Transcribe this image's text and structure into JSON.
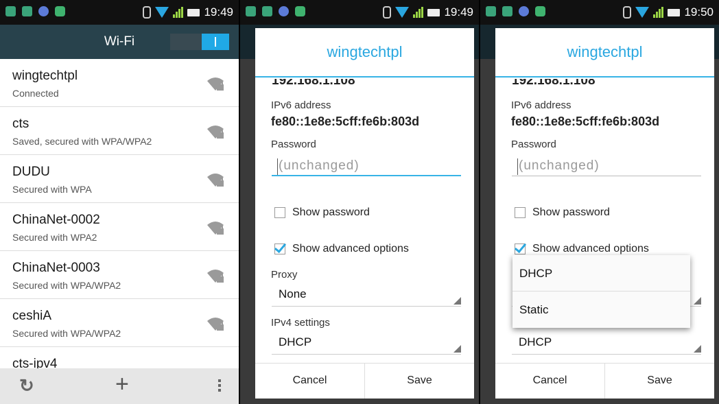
{
  "statusbar": {
    "time1": "19:49",
    "time2": "19:49",
    "time3": "19:50"
  },
  "wifi": {
    "title": "Wi-Fi",
    "networks": [
      {
        "name": "wingtechtpl",
        "status": "Connected"
      },
      {
        "name": "cts",
        "status": "Saved, secured with WPA/WPA2"
      },
      {
        "name": "DUDU",
        "status": "Secured with WPA"
      },
      {
        "name": "ChinaNet-0002",
        "status": "Secured with WPA2"
      },
      {
        "name": "ChinaNet-0003",
        "status": "Secured with WPA/WPA2"
      },
      {
        "name": "ceshiA",
        "status": "Secured with WPA/WPA2"
      },
      {
        "name": "cts-ipv4",
        "status": ""
      }
    ],
    "bottom": {
      "refresh": "↻",
      "add": "+"
    }
  },
  "dialog": {
    "title": "wingtechtpl",
    "ipv4_value": "192.168.1.108",
    "ipv6_label": "IPv6 address",
    "ipv6_value": "fe80::1e8e:5cff:fe6b:803d",
    "password_label": "Password",
    "password_placeholder": "(unchanged)",
    "show_password": "Show password",
    "show_advanced": "Show advanced options",
    "proxy_label": "Proxy",
    "proxy_value": "None",
    "ipv4_settings_label": "IPv4 settings",
    "ipv4_settings_value": "DHCP",
    "cancel": "Cancel",
    "save": "Save",
    "ip_options": [
      "DHCP",
      "Static"
    ]
  },
  "colors": {
    "accent": "#2aa7e0",
    "actionbar": "#28424c"
  }
}
